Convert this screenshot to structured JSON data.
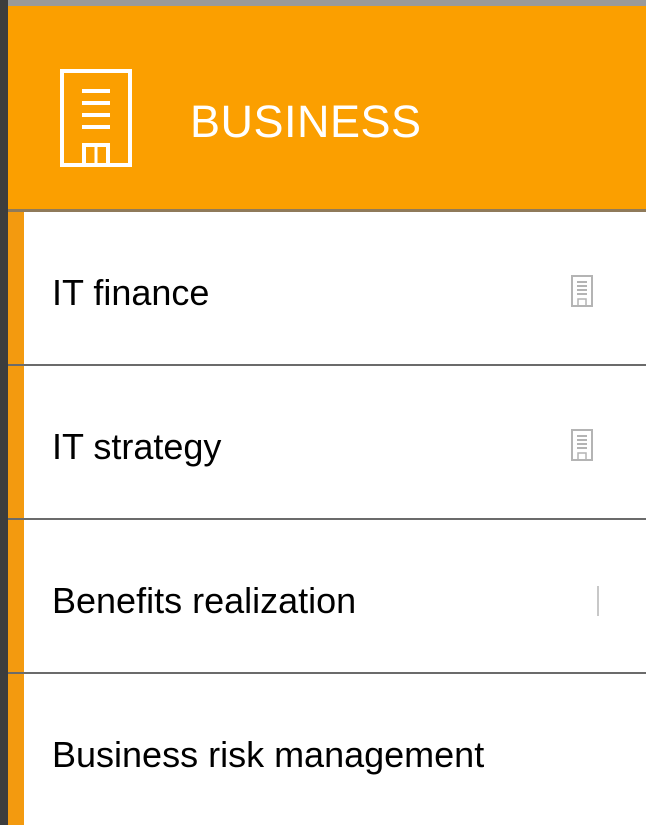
{
  "header": {
    "title": "BUSINESS",
    "icon": "building-icon",
    "background_color": "#fb9f00",
    "title_color": "#ffffff"
  },
  "list": {
    "accent_color": "#f39a0f",
    "items": [
      {
        "label": "IT finance",
        "icon": "building-icon"
      },
      {
        "label": "IT strategy",
        "icon": "building-icon"
      },
      {
        "label": "Benefits realization",
        "icon": "building-icon"
      },
      {
        "label": "Business risk management",
        "icon": ""
      }
    ]
  }
}
